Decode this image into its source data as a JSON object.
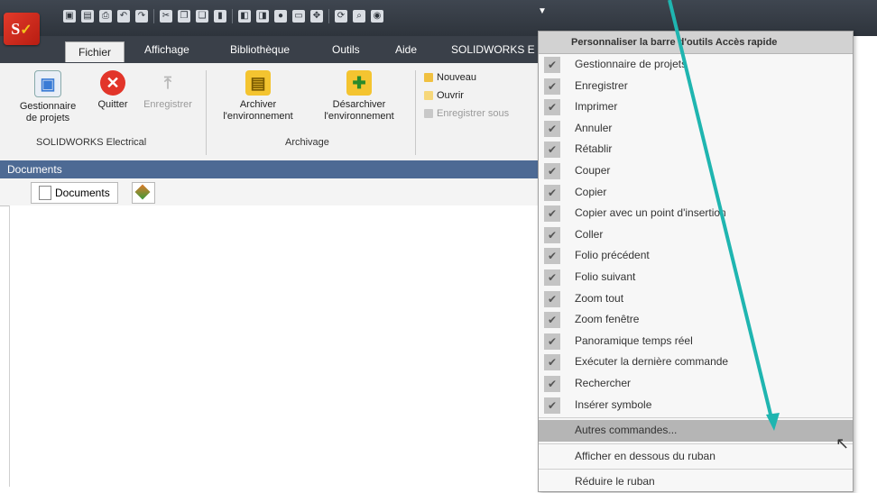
{
  "colors": {
    "accent_arrow": "#1fb5b0",
    "titlebar": "#2e343c",
    "menu_highlight": "#b5b5b5"
  },
  "quick_access_toolbar": {
    "icons": [
      "new-icon",
      "save-icon",
      "print-icon",
      "undo-icon",
      "redo-icon",
      "cut-icon",
      "copy-icon",
      "paste-icon",
      "prev-folio-icon",
      "next-folio-icon",
      "zoom-icon",
      "zoom-window-icon",
      "pan-icon",
      "repeat-icon",
      "search-icon",
      "symbol-icon"
    ],
    "partial_tab_label": "SOLIDWORKS E"
  },
  "tabs": [
    {
      "label": "Fichier",
      "active": true
    },
    {
      "label": "Affichage"
    },
    {
      "label": "Bibliothèque"
    },
    {
      "label": "Outils"
    },
    {
      "label": "Aide"
    }
  ],
  "ribbon": {
    "group1": {
      "buttons": [
        {
          "label": "Gestionnaire\nde projets",
          "icon": "project-manager-icon"
        },
        {
          "label": "Quitter",
          "icon": "quit-icon"
        },
        {
          "label": "Enregistrer",
          "icon": "save-upload-icon",
          "disabled": true
        }
      ],
      "label": "SOLIDWORKS Electrical"
    },
    "group2": {
      "buttons": [
        {
          "label": "Archiver\nl'environnement",
          "icon": "archive-icon"
        },
        {
          "label": "Désarchiver\nl'environnement",
          "icon": "unarchive-icon"
        }
      ],
      "label": "Archivage"
    },
    "small": [
      {
        "label": "Nouveau"
      },
      {
        "label": "Ouvrir"
      },
      {
        "label": "Enregistrer sous",
        "disabled": true
      }
    ]
  },
  "documents": {
    "title": "Documents",
    "tab_label": "Documents"
  },
  "menu": {
    "header": "Personnaliser la barre d'outils Accès rapide",
    "checked_items": [
      "Gestionnaire de projets",
      "Enregistrer",
      "Imprimer",
      "Annuler",
      "Rétablir",
      "Couper",
      "Copier",
      "Copier avec un point d'insertion",
      "Coller",
      "Folio précédent",
      "Folio suivant",
      "Zoom tout",
      "Zoom fenêtre",
      "Panoramique temps réel",
      "Exécuter la dernière commande",
      "Rechercher",
      "Insérer symbole"
    ],
    "more": "Autres commandes...",
    "below": "Afficher en dessous du ruban",
    "minimize": "Réduire le ruban"
  }
}
